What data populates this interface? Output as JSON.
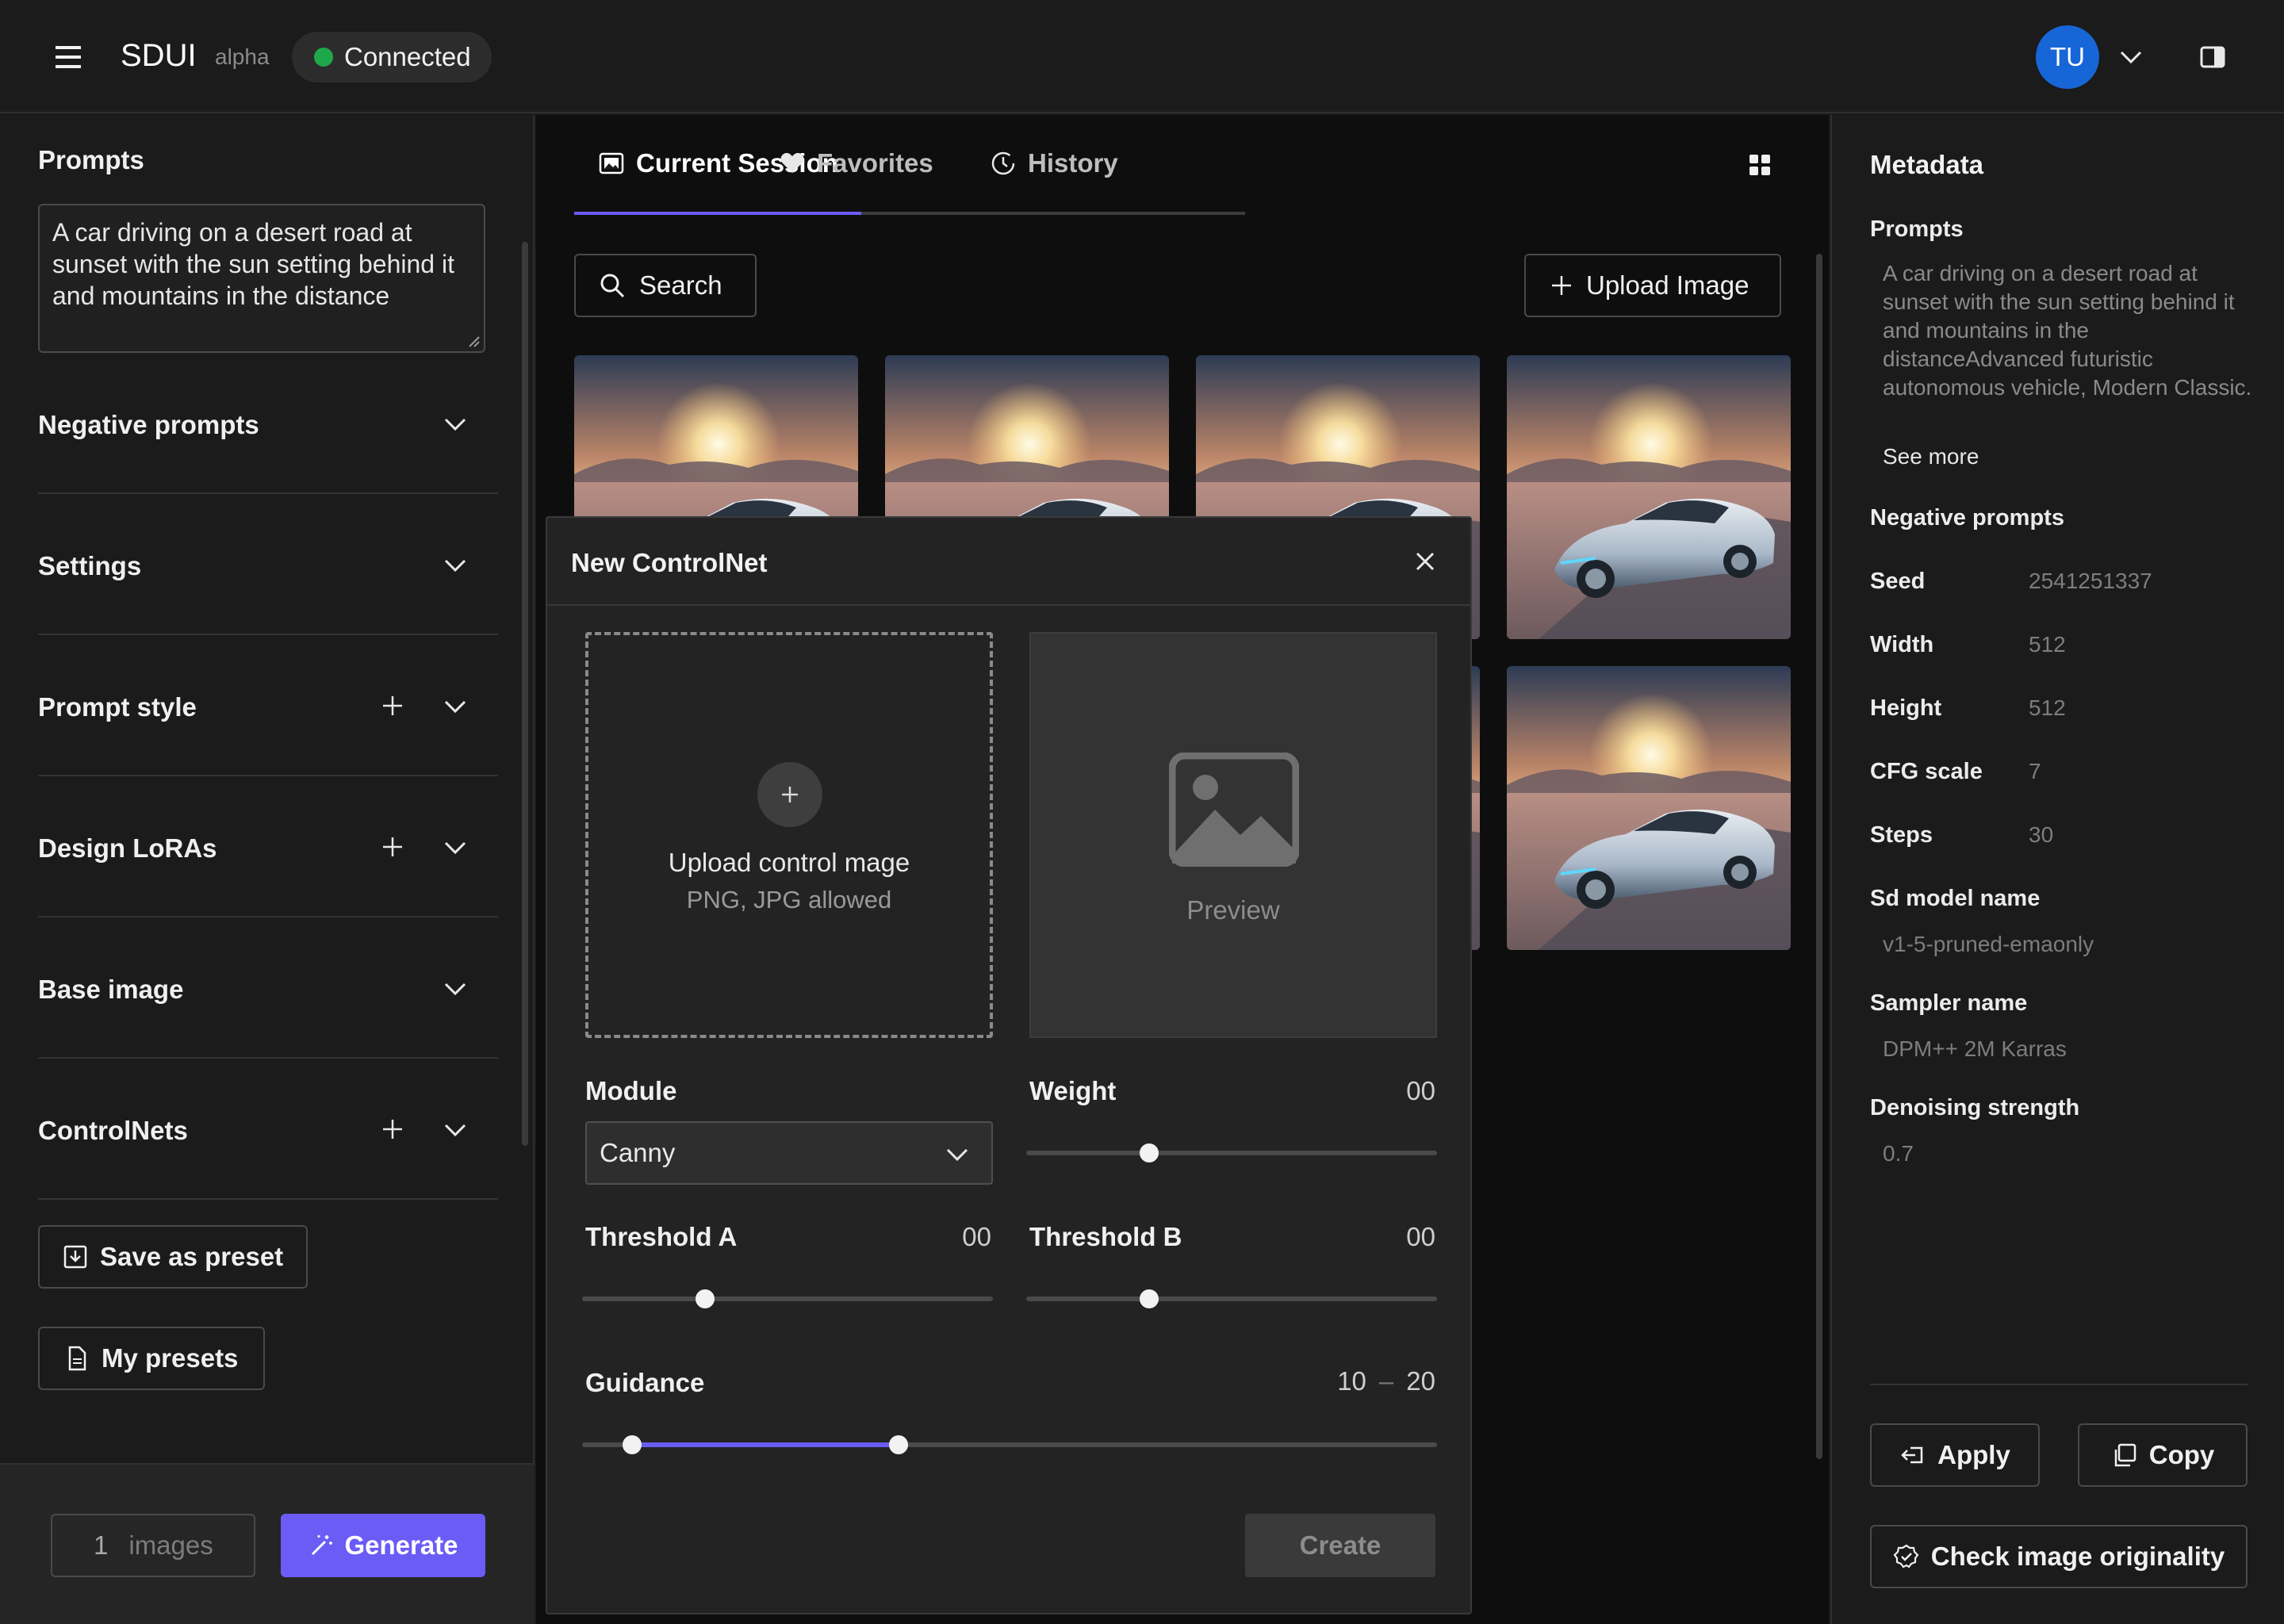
{
  "app": {
    "brand": "SDUI",
    "badge": "alpha",
    "connection_status": "Connected",
    "user_initials": "TU"
  },
  "colors": {
    "accent": "#6b5cf6",
    "connected": "#1fa84a",
    "avatar": "#1766d8"
  },
  "sidebar": {
    "prompts_title": "Prompts",
    "prompt_text": "A car driving on a desert road at sunset with the sun setting behind it and mountains in the distance",
    "sections": [
      {
        "label": "Negative prompts",
        "has_add": false
      },
      {
        "label": "Settings",
        "has_add": false
      },
      {
        "label": "Prompt style",
        "has_add": true
      },
      {
        "label": "Design LoRAs",
        "has_add": true
      },
      {
        "label": "Base image",
        "has_add": false
      },
      {
        "label": "ControlNets",
        "has_add": true
      }
    ],
    "save_preset_label": "Save as preset",
    "my_presets_label": "My presets",
    "image_count": "1",
    "image_count_unit": "images",
    "generate_label": "Generate"
  },
  "center": {
    "tabs": [
      {
        "label": "Current Session",
        "icon": "image-icon",
        "active": true
      },
      {
        "label": "Favorites",
        "icon": "heart-icon",
        "active": false
      },
      {
        "label": "History",
        "icon": "history-icon",
        "active": false
      }
    ],
    "search_label": "Search",
    "upload_label": "Upload Image"
  },
  "modal": {
    "title": "New ControlNet",
    "upload_title": "Upload control mage",
    "upload_hint": "PNG, JPG allowed",
    "preview_label": "Preview",
    "module_label": "Module",
    "module_value": "Canny",
    "weight_label": "Weight",
    "weight_value": "00",
    "weight_level": 0.3,
    "threshold_a_label": "Threshold A",
    "threshold_a_value": "00",
    "threshold_a_level": 0.3,
    "threshold_b_label": "Threshold B",
    "threshold_b_value": "00",
    "threshold_b_level": 0.3,
    "guidance_label": "Guidance",
    "guidance_min": "10",
    "guidance_sep": "–",
    "guidance_max": "20",
    "guidance_range": [
      0.058,
      0.37
    ],
    "create_label": "Create"
  },
  "metadata": {
    "title": "Metadata",
    "prompts_label": "Prompts",
    "prompts_value": "A car driving on a desert road at sunset with the sun setting behind it and mountains in the distanceAdvanced futuristic autonomous vehicle, Modern Classic.",
    "see_more": "See more",
    "negative_label": "Negative prompts",
    "seed_label": "Seed",
    "seed": "2541251337",
    "width_label": "Width",
    "width": "512",
    "height_label": "Height",
    "height": "512",
    "cfg_label": "CFG scale",
    "cfg": "7",
    "steps_label": "Steps",
    "steps": "30",
    "model_label": "Sd model name",
    "model": "v1-5-pruned-emaonly",
    "sampler_label": "Sampler name",
    "sampler": "DPM++ 2M Karras",
    "denoise_label": "Denoising strength",
    "denoise": "0.7",
    "apply_label": "Apply",
    "copy_label": "Copy",
    "originality_label": "Check image originality"
  }
}
